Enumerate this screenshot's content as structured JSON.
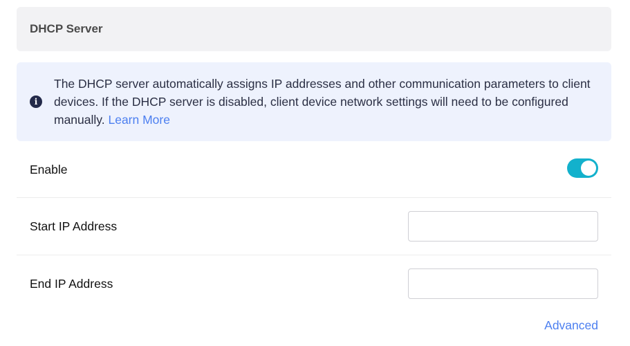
{
  "section": {
    "title": "DHCP Server"
  },
  "info": {
    "icon": "info-icon",
    "icon_glyph": "i",
    "text": "The DHCP server automatically assigns IP addresses and other communication parameters to client devices. If the DHCP server is disabled, client device network settings will need to be configured manually.",
    "link_label": "Learn More"
  },
  "settings": {
    "enable": {
      "label": "Enable",
      "value": true
    },
    "start_ip": {
      "label": "Start IP Address",
      "value": "",
      "placeholder": ""
    },
    "end_ip": {
      "label": "End IP Address",
      "value": "",
      "placeholder": ""
    }
  },
  "advanced_label": "Advanced",
  "colors": {
    "accent": "#13b1cc",
    "link": "#4c7ff0",
    "info_bg": "#eef2fd",
    "header_bg": "#f2f2f4"
  }
}
